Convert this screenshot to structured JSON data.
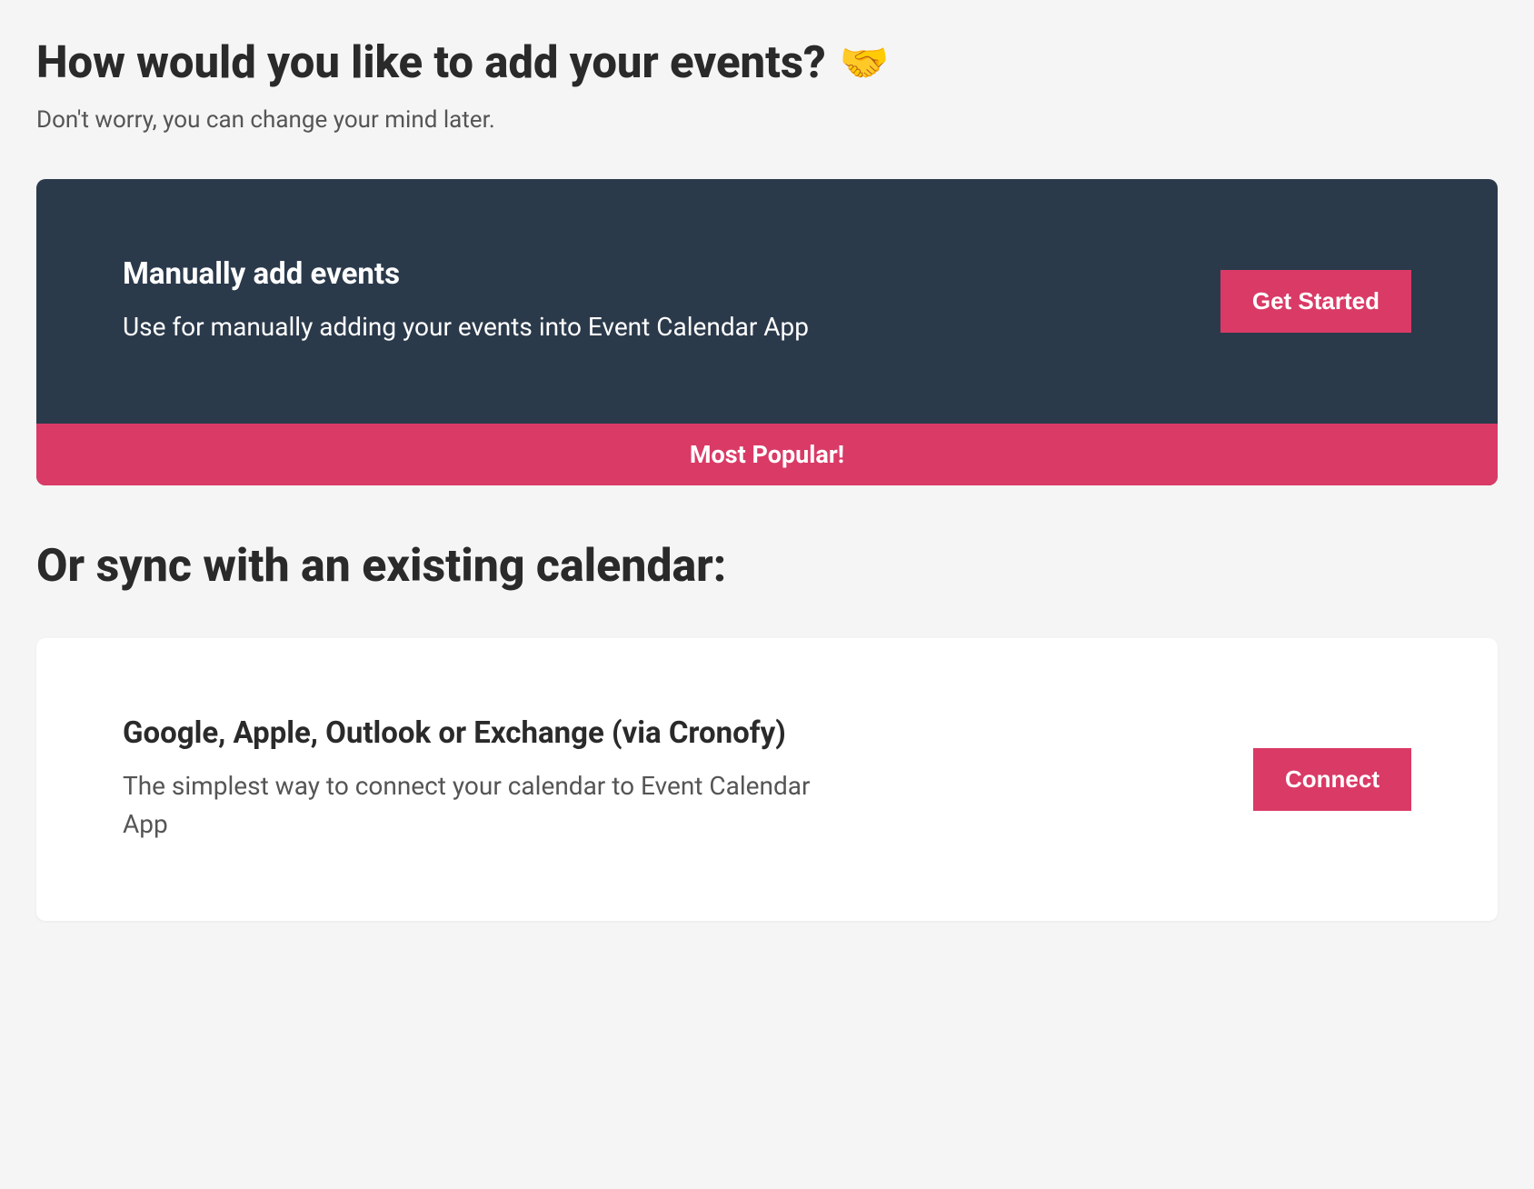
{
  "header": {
    "title": "How would you like to add your events?",
    "icon": "🤝",
    "subtitle": "Don't worry, you can change your mind later."
  },
  "manual_card": {
    "title": "Manually add events",
    "description": "Use for manually adding your events into Event Calendar App",
    "button_label": "Get Started",
    "badge": "Most Popular!"
  },
  "sync_section": {
    "title": "Or sync with an existing calendar:"
  },
  "sync_card": {
    "title": "Google, Apple, Outlook or Exchange (via Cronofy)",
    "description": "The simplest way to connect your calendar to Event Calendar App",
    "button_label": "Connect"
  },
  "colors": {
    "accent": "#da3a66",
    "dark_card": "#2b3a4b",
    "text_primary": "#2a2a2a",
    "text_secondary": "#555",
    "background": "#f5f5f5"
  }
}
